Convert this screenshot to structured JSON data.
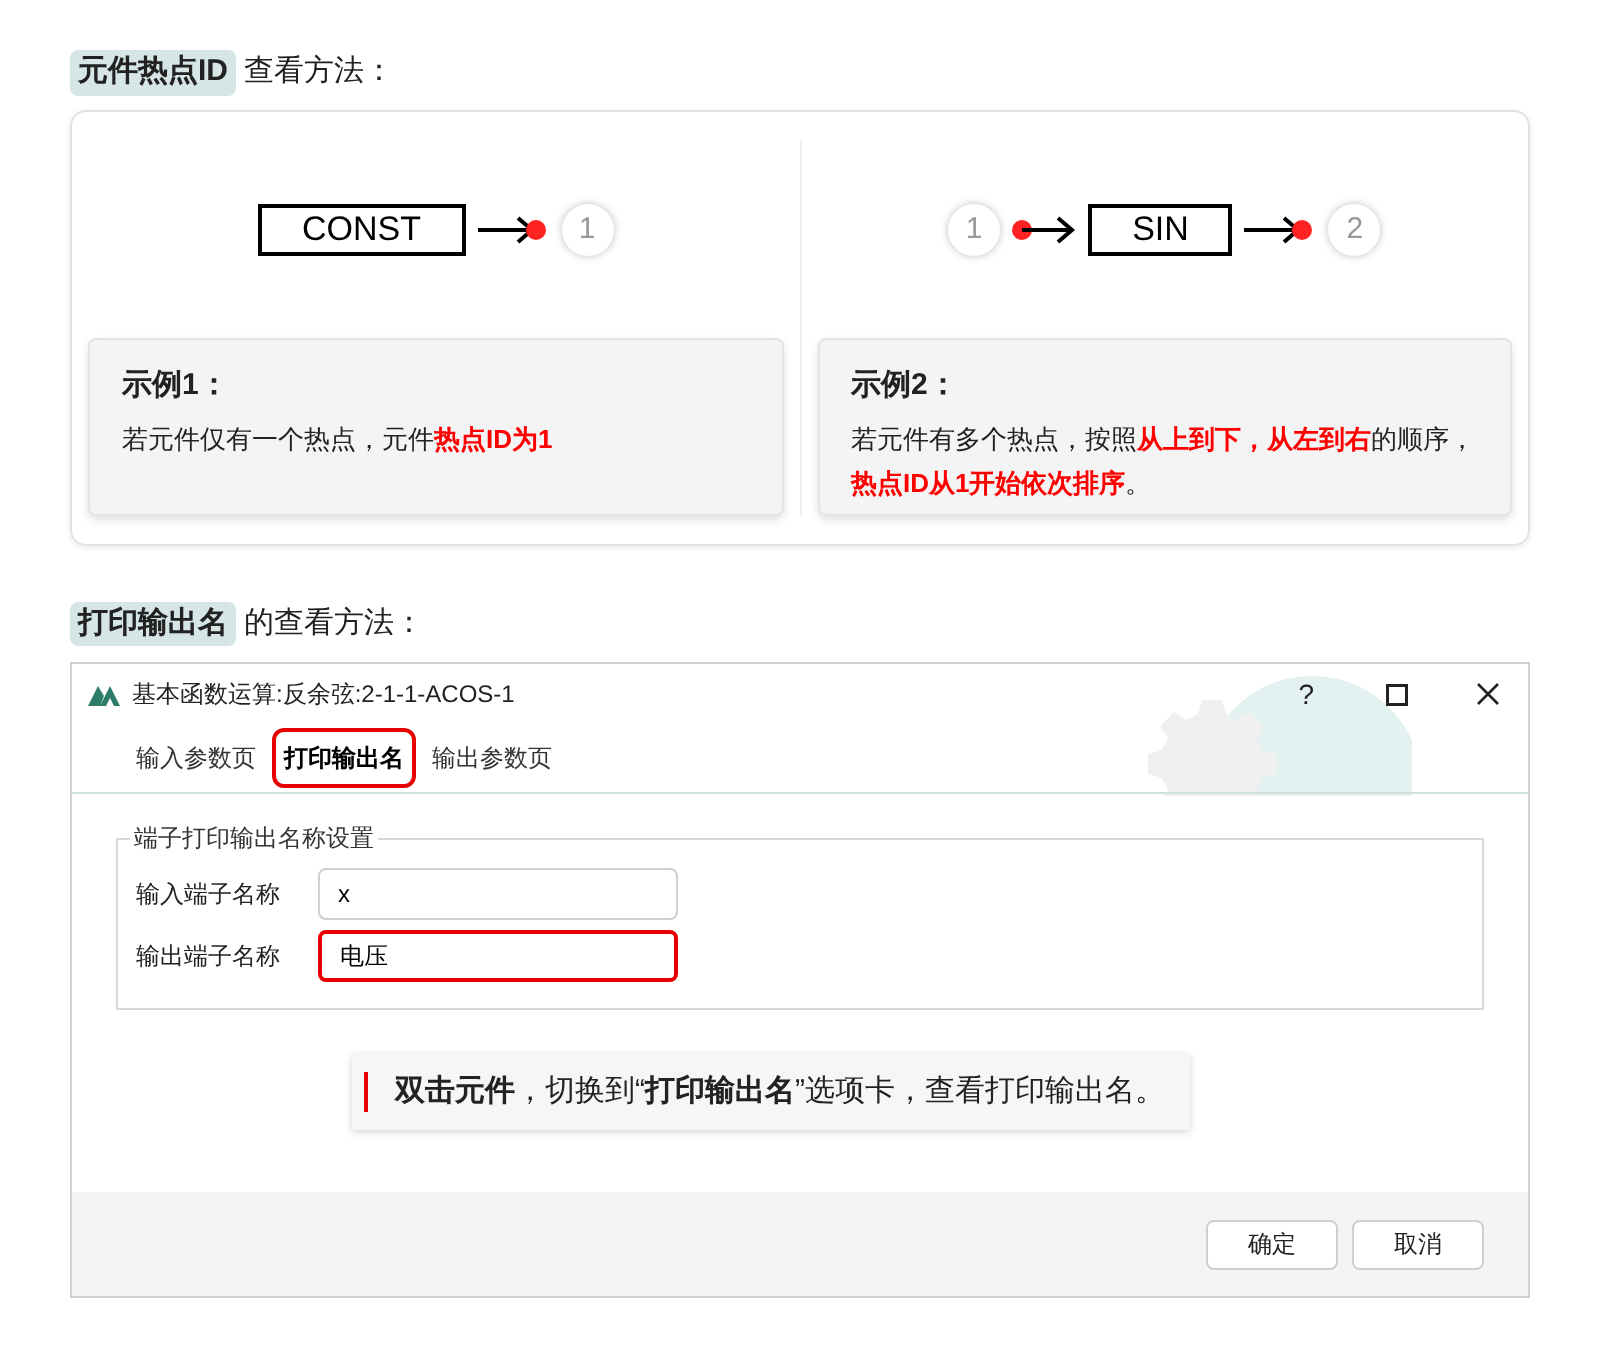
{
  "hotspot_section": {
    "heading": {
      "tag": "元件热点ID",
      "rest": "查看方法："
    },
    "examples": [
      {
        "diagram": {
          "block": "CONST",
          "output_ports": [
            "1"
          ]
        },
        "title": "示例1：",
        "description": [
          {
            "text": "若元件仅有一个热点，元件",
            "emphasis": false
          },
          {
            "text": "热点ID为1",
            "emphasis": true
          }
        ]
      },
      {
        "diagram": {
          "input_ports": [
            "1"
          ],
          "block": "SIN",
          "output_ports": [
            "2"
          ]
        },
        "title": "示例2：",
        "description": [
          {
            "text": "若元件有多个热点，按照",
            "emphasis": false
          },
          {
            "text": "从上到下，从左到右",
            "emphasis": true
          },
          {
            "text": "的顺序，",
            "emphasis": false
          },
          {
            "text": "热点ID从1开始依次排序",
            "emphasis": true
          },
          {
            "text": "。",
            "emphasis": false
          }
        ]
      }
    ]
  },
  "print_section": {
    "heading": {
      "tag": "打印输出名",
      "rest": "的查看方法："
    },
    "dialog": {
      "title": "基本函数运算:反余弦:2-1-1-ACOS-1",
      "help": "?",
      "tabs": [
        {
          "label": "输入参数页",
          "selected": false,
          "highlighted": false
        },
        {
          "label": "打印输出名",
          "selected": true,
          "highlighted": true
        },
        {
          "label": "输出参数页",
          "selected": false,
          "highlighted": false
        }
      ],
      "group": {
        "legend": "端子打印输出名称设置",
        "fields": [
          {
            "label": "输入端子名称",
            "value": "x",
            "highlighted": false
          },
          {
            "label": "输出端子名称",
            "value": "电压",
            "highlighted": true
          }
        ]
      },
      "callout": "**双击元件**，切换到“**打印输出名**”选项卡，查看打印输出名。",
      "buttons": [
        "确定",
        "取消"
      ]
    }
  }
}
